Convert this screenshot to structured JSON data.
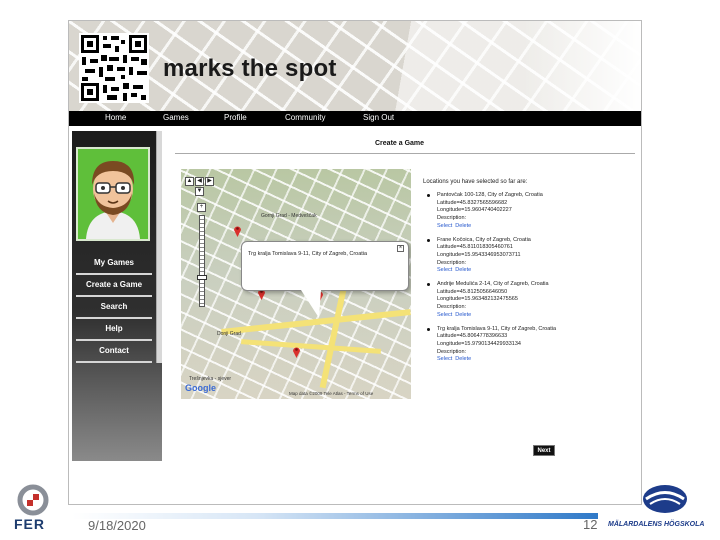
{
  "app": {
    "brand_title": "marks the spot",
    "nav": [
      "Home",
      "Games",
      "Profile",
      "Community",
      "Sign Out"
    ]
  },
  "sidebar": {
    "items": [
      "My Games",
      "Create a Game",
      "Search",
      "Help",
      "Contact"
    ]
  },
  "main": {
    "title": "Create a Game",
    "locations_heading": "Locations you have selected so far are:",
    "locations": [
      {
        "address": "Pantovčak 100-128, City of Zagreb, Croatia",
        "latitude": "Latitude=45.8327565596682",
        "longitude": "Longitude=15.9604740402227",
        "description": "Description:",
        "actions": [
          "Select",
          "Delete"
        ]
      },
      {
        "address": "Frane Kočoica, City of Zagreb, Croatia",
        "latitude": "Latitude=45.811018305460761",
        "longitude": "Longitude=15.9543346953073711",
        "description": "Description:",
        "actions": [
          "Select",
          "Delete"
        ]
      },
      {
        "address": "Andrije Medulića 2-14, City of Zagreb, Croatia",
        "latitude": "Latitude=45.8125056646050",
        "longitude": "Longitude=15.963482132475565",
        "description": "Description:",
        "actions": [
          "Select",
          "Delete"
        ]
      },
      {
        "address": "Trg kralja Tomislava 9-11, City of Zagreb, Croatia",
        "latitude": "Latitude=45.8064778396633",
        "longitude": "Longitude=15.9790134429933134",
        "description": "Description:",
        "actions": [
          "Select",
          "Delete"
        ]
      }
    ],
    "next_label": "Next"
  },
  "map": {
    "info_window_text": "Trg kralja Tomislava 9-11, City of Zagreb, Croatia",
    "labels": [
      "Gornji Grad - Medveščak",
      "Donji Grad",
      "Trešnjevka - sjever"
    ],
    "google_label": "Google",
    "copyright": "Map data ©2009 Tele Atlas - Terms of Use"
  },
  "slide": {
    "date": "9/18/2020",
    "page_number": "12",
    "left_logo_text": "FER",
    "right_logo_text": "MÄLARDALENS HÖGSKOLA"
  },
  "colors": {
    "nav_bar": "#000000",
    "avatar_bg": "#5fbf3a",
    "link": "#2255cc",
    "footer_accent": "#2f79c8"
  }
}
